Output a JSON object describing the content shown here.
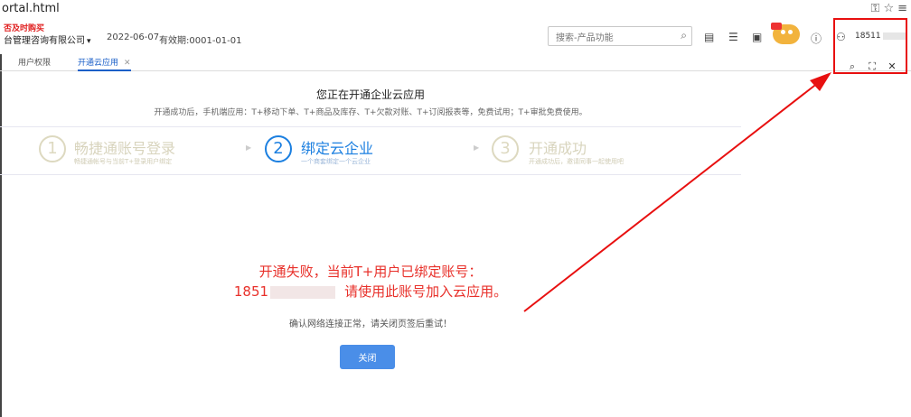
{
  "browser": {
    "url": "ortal.html"
  },
  "header": {
    "promo": "否及时购买",
    "company": "台管理咨询有限公司",
    "date": "2022-06-07",
    "validity": "有效期:0001-01-01",
    "search_placeholder": "搜索-产品功能",
    "user_phone": "18511"
  },
  "tabs": [
    {
      "label": "用户权限",
      "active": false
    },
    {
      "label": "开通云应用",
      "active": true
    }
  ],
  "main": {
    "title": "您正在开通企业云应用",
    "subtitle": "开通成功后，手机端应用：T+移动下单、T+商品及库存、T+欠款对账、T+订阅报表等，免费试用；T+审批免费使用。",
    "steps": [
      {
        "number": "1",
        "title": "畅捷通账号登录",
        "desc": "畅捷通帐号与当前T+登录用户绑定"
      },
      {
        "number": "2",
        "title": "绑定云企业",
        "desc": "一个商套绑定一个云企业"
      },
      {
        "number": "3",
        "title": "开通成功",
        "desc": "开通成功后，邀请同事一起使用吧"
      }
    ],
    "error_line1": "开通失败，当前T+用户已绑定账号：",
    "error_line2_prefix": "1851",
    "error_line2_suffix": "请使用此账号加入云应用。",
    "hint": "确认网络连接正常，请关闭页签后重试！",
    "close_label": "关闭"
  },
  "colors": {
    "accent": "#1b7fe0",
    "error": "#e8302a",
    "annotation": "#e81010",
    "button": "#4a8ee8"
  }
}
